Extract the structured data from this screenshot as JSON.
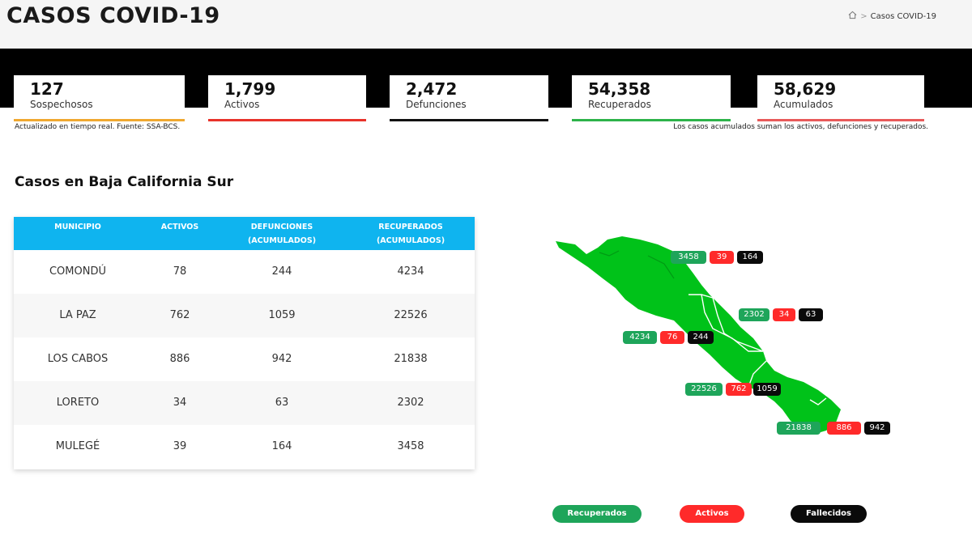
{
  "header": {
    "title": "CASOS COVID-19",
    "breadcrumb": {
      "current": "Casos COVID-19"
    }
  },
  "stats": [
    {
      "value": "127",
      "label": "Sospechosos",
      "color": "#f0a830"
    },
    {
      "value": "1,799",
      "label": "Activos",
      "color": "#e8322a"
    },
    {
      "value": "2,472",
      "label": "Defunciones",
      "color": "#111111"
    },
    {
      "value": "54,358",
      "label": "Recuperados",
      "color": "#2db34a"
    },
    {
      "value": "58,629",
      "label": "Acumulados",
      "color": "#e85a5a"
    }
  ],
  "notes": {
    "left": "Actualizado en tiempo real. Fuente: SSA-BCS.",
    "right": "Los casos acumulados suman los activos, defunciones y recuperados."
  },
  "section": {
    "title": "Casos en Baja California Sur"
  },
  "table": {
    "headers": {
      "municipio": "MUNICIPIO",
      "activos": "ACTIVOS",
      "defunciones_1": "DEFUNCIONES",
      "defunciones_2": "(ACUMULADOS)",
      "recuperados_1": "RECUPERADOS",
      "recuperados_2": "(ACUMULADOS)"
    },
    "rows": [
      {
        "municipio": "COMONDÚ",
        "activos": "78",
        "defunciones": "244",
        "recuperados": "4234"
      },
      {
        "municipio": "LA PAZ",
        "activos": "762",
        "defunciones": "1059",
        "recuperados": "22526"
      },
      {
        "municipio": "LOS CABOS",
        "activos": "886",
        "defunciones": "942",
        "recuperados": "21838"
      },
      {
        "municipio": "LORETO",
        "activos": "34",
        "defunciones": "63",
        "recuperados": "2302"
      },
      {
        "municipio": "MULEGÉ",
        "activos": "39",
        "defunciones": "164",
        "recuperados": "3458"
      }
    ]
  },
  "map": {
    "fill_color": "#00c219",
    "labels": [
      {
        "recuperados": "3458",
        "activos": "39",
        "fallecidos": "164"
      },
      {
        "recuperados": "2302",
        "activos": "34",
        "fallecidos": "63"
      },
      {
        "recuperados": "4234",
        "activos": "76",
        "fallecidos": "244"
      },
      {
        "recuperados": "22526",
        "activos": "762",
        "fallecidos": "1059"
      },
      {
        "recuperados": "21838",
        "activos": "886",
        "fallecidos": "942"
      }
    ]
  },
  "legend": {
    "recuperados": "Recuperados",
    "activos": "Activos",
    "fallecidos": "Fallecidos"
  }
}
